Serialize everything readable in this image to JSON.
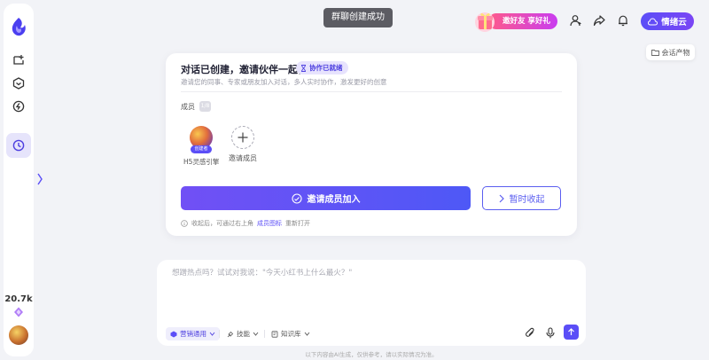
{
  "toast": {
    "text": "群聊创建成功"
  },
  "header": {
    "promo_text": "邀好友 享好礼",
    "cloud_button": "情绪云",
    "artifacts_button": "会话产物"
  },
  "sidebar": {
    "usage_count": "20.7k"
  },
  "invite_card": {
    "title": "对话已创建，邀请伙伴一起协作",
    "ready_badge": "协作已就绪",
    "description": "邀请您的同事、专家或朋友加入对话，多人实时协作，激发更好的创意",
    "members_label": "成员",
    "members_count": "1/8",
    "members": [
      {
        "name": "H5灵感引擎",
        "tag": "创建者"
      }
    ],
    "invite_member_label": "邀请成员",
    "invite_button": "邀请成员加入",
    "later_button": "暂时收起",
    "hint_prefix": "收起后，可通过右上角",
    "hint_link": "成员图标",
    "hint_suffix": "重新打开"
  },
  "composer": {
    "placeholder": "想蹭热点吗？试试对我说：\"今天小红书上什么最火？\"",
    "value": "",
    "chips": [
      {
        "label": "营销通用"
      },
      {
        "label": "技能"
      },
      {
        "label": "知识库"
      }
    ]
  },
  "footer": {
    "note": "以下内容由AI生成，仅供参考，请以实际情况为准。"
  },
  "colors": {
    "accent": "#5b4ef7",
    "background": "#f2f3f7",
    "toast": "#5c5c63"
  }
}
